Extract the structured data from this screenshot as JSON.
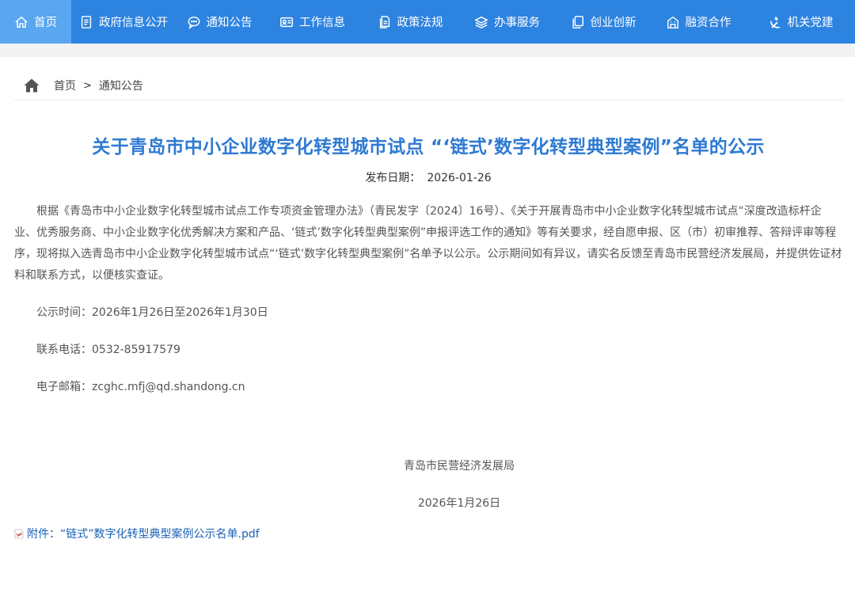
{
  "nav": {
    "items": [
      {
        "label": "首页",
        "icon": "home-icon",
        "active": true
      },
      {
        "label": "政府信息公开",
        "icon": "document-icon",
        "active": false
      },
      {
        "label": "通知公告",
        "icon": "chat-icon",
        "active": false
      },
      {
        "label": "工作信息",
        "icon": "id-card-icon",
        "active": false
      },
      {
        "label": "政策法规",
        "icon": "files-icon",
        "active": false
      },
      {
        "label": "办事服务",
        "icon": "layers-icon",
        "active": false
      },
      {
        "label": "创业创新",
        "icon": "copy-icon",
        "active": false
      },
      {
        "label": "融资合作",
        "icon": "building-icon",
        "active": false
      },
      {
        "label": "机关党建",
        "icon": "party-emblem-icon",
        "active": false
      }
    ]
  },
  "breadcrumb": {
    "home": "首页",
    "separator": ">",
    "current": "通知公告"
  },
  "article": {
    "title": "关于青岛市中小企业数字化转型城市试点 “‘链式’数字化转型典型案例”名单的公示",
    "date_label": "发布日期：",
    "date": "2026-01-26",
    "body": "根据《青岛市中小企业数字化转型城市试点工作专项资金管理办法》（青民发字〔2024〕16号）、《关于开展青岛市中小企业数字化转型城市试点“深度改造标杆企业、优秀服务商、中小企业数字化优秀解决方案和产品、‘链式’数字化转型典型案例”申报评选工作的通知》等有关要求，经自愿申报、区（市）初审推荐、答辩评审等程序，现将拟入选青岛市中小企业数字化转型城市试点“‘链式’数字化转型典型案例”名单予以公示。公示期间如有异议，请实名反馈至青岛市民营经济发展局，并提供佐证材料和联系方式，以便核实查证。",
    "period": "公示时间：2026年1月26日至2026年1月30日",
    "phone": "联系电话：0532-85917579",
    "email": "电子邮箱：zcghc.mfj@qd.shandong.cn",
    "signature_org": "青岛市民营经济发展局",
    "signature_date": "2026年1月26日",
    "attachment": "附件：“链式”数字化转型典型案例公示名单.pdf"
  },
  "colors": {
    "nav_bg": "#2d83e0",
    "nav_active": "#5aa6f0",
    "title": "#2e7ad3",
    "link": "#1a5fb4"
  }
}
